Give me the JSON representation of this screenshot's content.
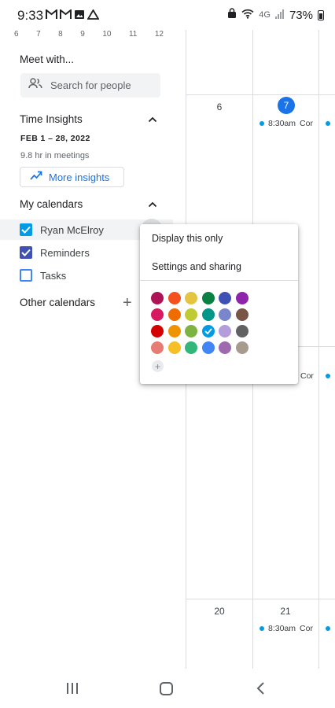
{
  "status_bar": {
    "time": "9:33",
    "signal_text": "4G",
    "battery_text": "73%"
  },
  "mini_calendar": {
    "days": [
      "6",
      "7",
      "8",
      "9",
      "10",
      "11",
      "12"
    ]
  },
  "meet_with": {
    "title": "Meet with...",
    "search_placeholder": "Search for people"
  },
  "time_insights": {
    "title": "Time Insights",
    "date_range": "FEB 1 – 28, 2022",
    "hours": "9.8 hr in meetings",
    "button_label": "More insights"
  },
  "my_calendars": {
    "title": "My calendars",
    "items": [
      {
        "label": "Ryan McElroy",
        "checked": true,
        "color": "#039be5"
      },
      {
        "label": "Reminders",
        "checked": true,
        "color": "#3f51b5"
      },
      {
        "label": "Tasks",
        "checked": false,
        "color": "#4285f4"
      }
    ]
  },
  "other_calendars": {
    "title": "Other calendars"
  },
  "popup_menu": {
    "items": [
      "Display this only",
      "Settings and sharing"
    ],
    "colors": [
      "#ad1457",
      "#f4511e",
      "#e4c441",
      "#0b8043",
      "#3f51b5",
      "#8e24aa",
      "#d81b60",
      "#ef6c00",
      "#c0ca33",
      "#009688",
      "#7986cb",
      "#795548",
      "#d50000",
      "#f09300",
      "#7cb342",
      "#039be5",
      "#b39ddb",
      "#616161",
      "#e67c73",
      "#f6bf26",
      "#33b679",
      "#4285f4",
      "#9e69af",
      "#a79b8e"
    ],
    "selected_color": "#039be5",
    "add_label": "+"
  },
  "calendar_grid": {
    "week1_days": [
      "6",
      "7"
    ],
    "today": "7",
    "week3_days": [
      "20",
      "21"
    ],
    "event_time": "8:30am",
    "event_title": "Cor",
    "event_color": "#039be5"
  }
}
